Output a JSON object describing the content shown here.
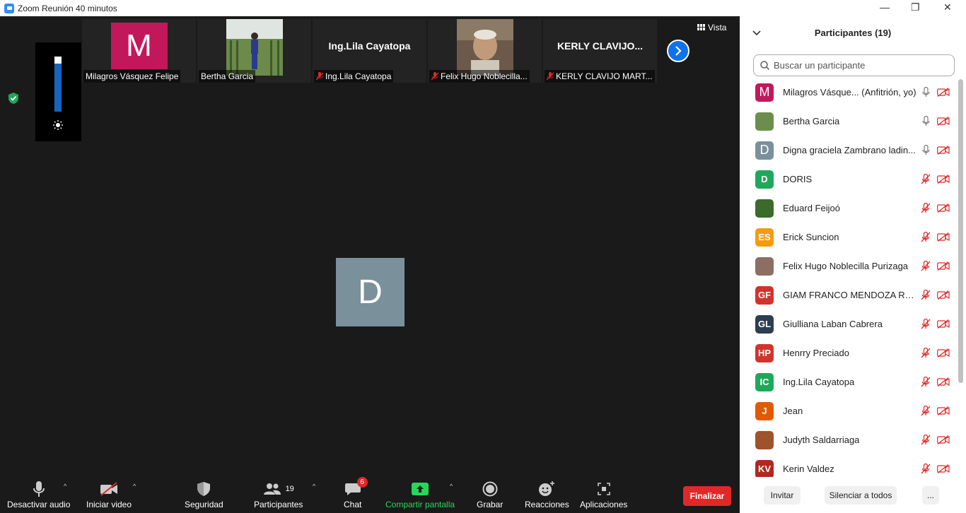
{
  "window": {
    "title": "Zoom Reunión 40 minutos",
    "minimize": "—",
    "maximize": "❐",
    "close": "✕"
  },
  "strip": [
    {
      "display": "M",
      "name": "Milagros Vásquez Felipe",
      "muted": false,
      "kind": "avatar"
    },
    {
      "display": "",
      "name": "Bertha Garcia",
      "muted": false,
      "kind": "photo"
    },
    {
      "display": "Ing.Lila Cayatopa",
      "name": "Ing.Lila Cayatopa",
      "muted": true,
      "kind": "text"
    },
    {
      "display": "",
      "name": "Felix Hugo Noblecilla...",
      "muted": true,
      "kind": "photo2"
    },
    {
      "display": "KERLY  CLAVIJO...",
      "name": "KERLY CLAVIJO MART...",
      "muted": true,
      "kind": "text"
    }
  ],
  "view_label": "Vista",
  "active_speaker_initial": "D",
  "toolbar": {
    "mute": "Desactivar audio",
    "video": "Iniciar video",
    "security": "Seguridad",
    "participants": "Participantes",
    "participants_count": "19",
    "chat": "Chat",
    "chat_badge": "6",
    "share": "Compartir pantalla",
    "record": "Grabar",
    "reactions": "Reacciones",
    "apps": "Aplicaciones",
    "end": "Finalizar"
  },
  "panel": {
    "title": "Participantes (19)",
    "search_placeholder": "Buscar un participante",
    "participants": [
      {
        "initials": "M",
        "color": "#c2185b",
        "name": "Milagros Vásque... (Anfitrión, yo)",
        "mic_on": true,
        "big": true
      },
      {
        "initials": "",
        "color": "#6b8e4e",
        "name": "Bertha Garcia",
        "mic_on": true,
        "big": false
      },
      {
        "initials": "D",
        "color": "#7a919c",
        "name": "Digna graciela Zambrano ladin...",
        "mic_on": true,
        "big": true
      },
      {
        "initials": "D",
        "color": "#1fa85a",
        "name": "DORIS",
        "mic_on": false,
        "big": false
      },
      {
        "initials": "",
        "color": "#3b6b2a",
        "name": "Eduard Feijoó",
        "mic_on": false,
        "big": false
      },
      {
        "initials": "ES",
        "color": "#f39c12",
        "name": "Erick Suncion",
        "mic_on": false,
        "big": false
      },
      {
        "initials": "",
        "color": "#8d6e63",
        "name": "Felix Hugo Noblecilla Purizaga",
        "mic_on": false,
        "big": false
      },
      {
        "initials": "GF",
        "color": "#d0342c",
        "name": "GIAM FRANCO MENDOZA RA...",
        "mic_on": false,
        "big": false
      },
      {
        "initials": "GL",
        "color": "#2c3e50",
        "name": "Giulliana Laban Cabrera",
        "mic_on": false,
        "big": false
      },
      {
        "initials": "HP",
        "color": "#d0342c",
        "name": "Henrry Preciado",
        "mic_on": false,
        "big": false
      },
      {
        "initials": "IC",
        "color": "#1fa85a",
        "name": "Ing.Lila Cayatopa",
        "mic_on": false,
        "big": false
      },
      {
        "initials": "J",
        "color": "#e05a00",
        "name": "Jean",
        "mic_on": false,
        "big": false
      },
      {
        "initials": "",
        "color": "#a0522d",
        "name": "Judyth Saldarriaga",
        "mic_on": false,
        "big": false
      },
      {
        "initials": "KV",
        "color": "#b0281e",
        "name": "Kerin Valdez",
        "mic_on": false,
        "big": false
      }
    ],
    "invite": "Invitar",
    "mute_all": "Silenciar a todos",
    "more": "..."
  }
}
